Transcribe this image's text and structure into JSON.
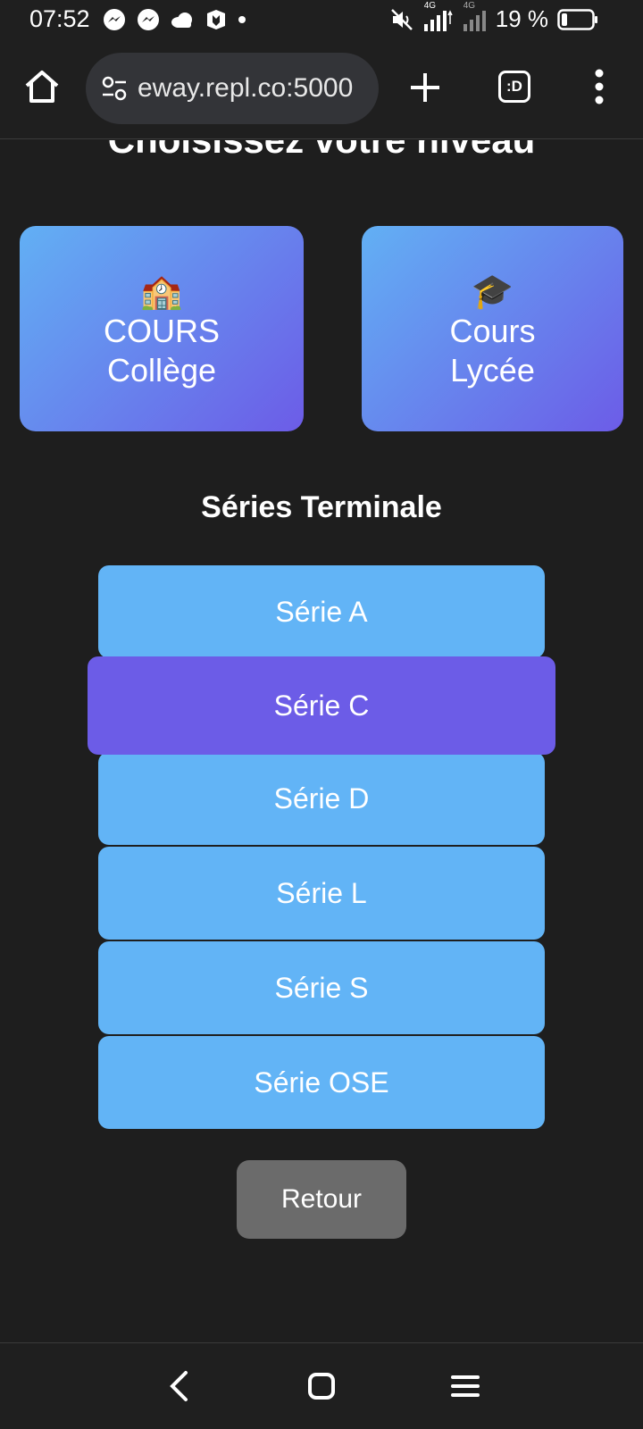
{
  "status_bar": {
    "time": "07:52",
    "net_label_1": "4G",
    "net_label_2": "4G",
    "battery_percent": "19 %",
    "battery_level": 0.19,
    "icons": [
      "messenger-icon",
      "messenger-icon",
      "cloud-icon",
      "app-icon",
      "dot-icon",
      "mute-icon",
      "signal-icon",
      "signal-icon",
      "battery-icon"
    ]
  },
  "browser": {
    "url": "eway.repl.co:5000",
    "tabs_label": ":D"
  },
  "page": {
    "title": "Choisissez votre niveau",
    "levels": [
      {
        "emoji": "🏫",
        "line1": "COURS",
        "line2": "Collège"
      },
      {
        "emoji": "🎓",
        "line1": "Cours",
        "line2": "Lycée"
      }
    ],
    "section_title": "Séries Terminale",
    "series": [
      "Série A",
      "Série C",
      "Série D",
      "Série L",
      "Série S",
      "Série OSE"
    ],
    "active_series": "Série C",
    "back_label": "Retour"
  },
  "colors": {
    "background": "#1e1e1e",
    "serie_button": "#62b4f6",
    "serie_active": "#6c5ce7",
    "gradient_start": "#62b0f4",
    "gradient_end": "#6c5ce7",
    "back_button": "#6b6b6b"
  }
}
